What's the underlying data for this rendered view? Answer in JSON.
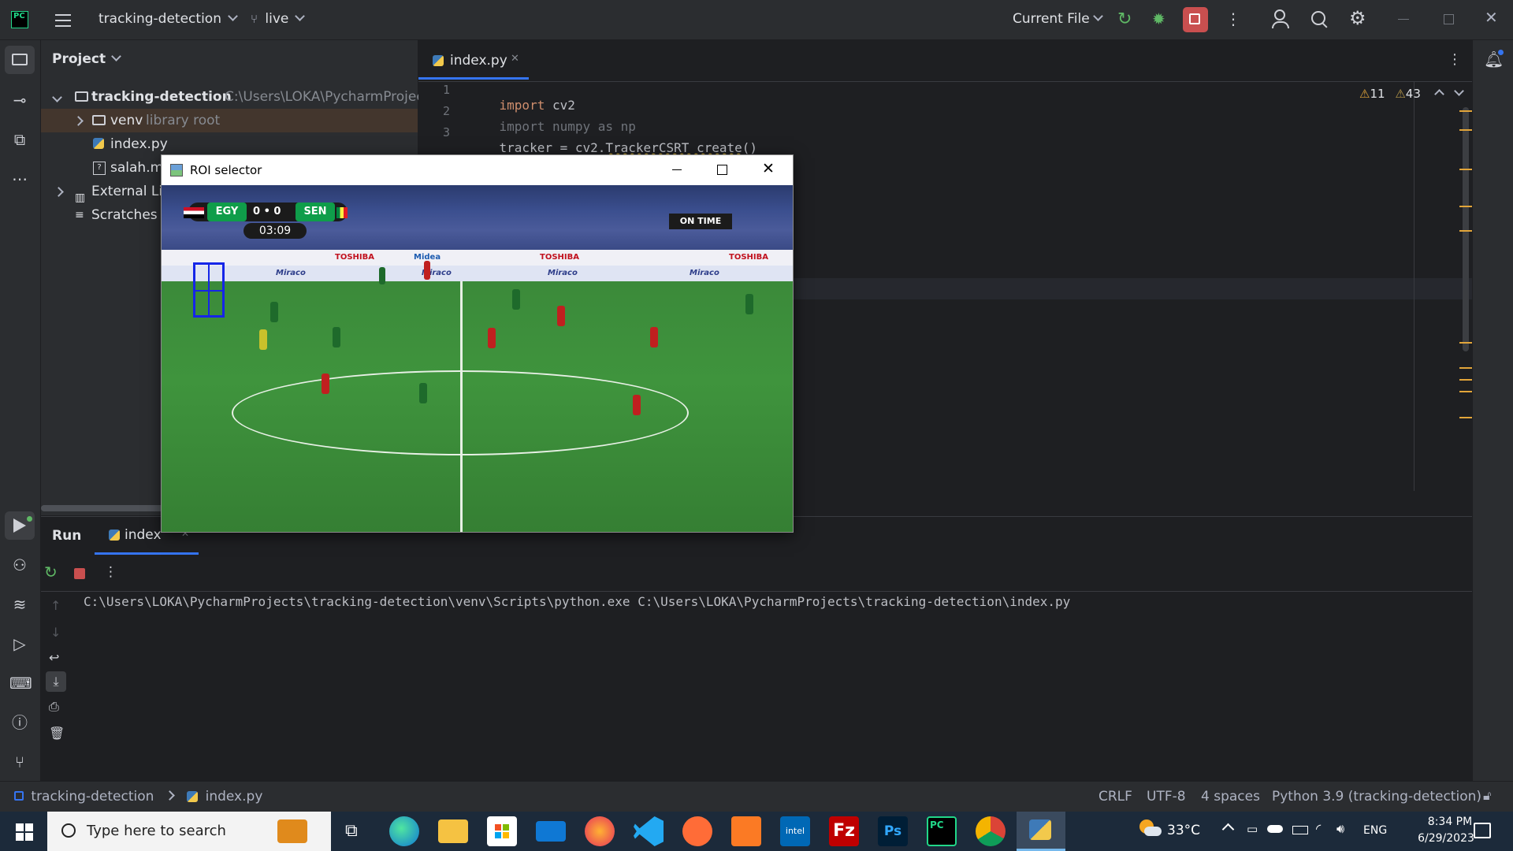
{
  "titlebar": {
    "project_name": "tracking-detection",
    "branch": "live",
    "run_config": "Current File"
  },
  "project_panel": {
    "header": "Project",
    "tree": {
      "root_name": "tracking-detection",
      "root_path": "C:\\Users\\LOKA\\PycharmProjects",
      "venv": "venv",
      "venv_note": "library root",
      "file1": "index.py",
      "file2": "salah.mp",
      "external": "External Lib",
      "scratches": "Scratches a"
    }
  },
  "editor": {
    "tab_label": "index.py",
    "warnings": "11",
    "weak_warnings": "43",
    "lines": [
      {
        "num": "1",
        "text_kw": "import",
        "text_rest": " cv2"
      },
      {
        "num": "2",
        "text_kw": "import",
        "text_rest": " numpy as np"
      },
      {
        "num": "3",
        "text_pre": "tracker = cv2.",
        "text_fn": "TrackerCSRT_create",
        "text_post": "()"
      }
    ]
  },
  "run_panel": {
    "tab_run": "Run",
    "tab_index": "index",
    "output": "C:\\Users\\LOKA\\PycharmProjects\\tracking-detection\\venv\\Scripts\\python.exe C:\\Users\\LOKA\\PycharmProjects\\tracking-detection\\index.py"
  },
  "statusbar": {
    "breadcrumb_project": "tracking-detection",
    "breadcrumb_file": "index.py",
    "line_sep": "CRLF",
    "encoding": "UTF-8",
    "indent": "4 spaces",
    "interpreter": "Python 3.9 (tracking-detection)"
  },
  "roi_window": {
    "title": "ROI selector",
    "score_team1": "EGY",
    "score": "0 • 0",
    "score_team2": "SEN",
    "clock": "03:09",
    "ad_toshiba": "TOSHIBA",
    "ad_miraco": "Miraco",
    "ad_midea": "Midea",
    "broadcaster": "ON TIME"
  },
  "taskbar": {
    "search_placeholder": "Type here to search",
    "weather": "33°C",
    "lang": "ENG",
    "time": "8:34 PM",
    "date": "6/29/2023"
  },
  "colors": {
    "ide_bg": "#1e1f22",
    "panel_bg": "#2b2d30",
    "keyword": "#cf8e6d",
    "warning": "#e2a53a",
    "stop_red": "#c94f4f",
    "run_green": "#5fb865"
  }
}
